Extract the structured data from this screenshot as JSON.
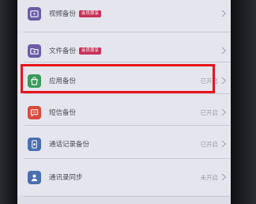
{
  "colors": {
    "highlight": "#e8141c",
    "badge": "#c8325a",
    "icon_purple": "#6b5ca5",
    "icon_green": "#3a9a5a",
    "icon_red": "#d84b3c",
    "icon_blue": "#4a6fb0"
  },
  "rows": [
    {
      "label": "视频备份",
      "badge": "会员尊享",
      "status": "",
      "icon": "video-icon"
    },
    {
      "label": "文件备份",
      "badge": "会员尊享",
      "status": "",
      "icon": "folder-icon"
    },
    {
      "label": "应用备份",
      "badge": "",
      "status": "已开启",
      "icon": "app-store-icon"
    },
    {
      "label": "短信备份",
      "badge": "",
      "status": "已开启",
      "icon": "message-icon"
    },
    {
      "label": "通话记录备份",
      "badge": "",
      "status": "已开启",
      "icon": "phone-log-icon"
    },
    {
      "label": "通讯录同步",
      "badge": "",
      "status": "未开启",
      "icon": "contacts-icon"
    }
  ]
}
